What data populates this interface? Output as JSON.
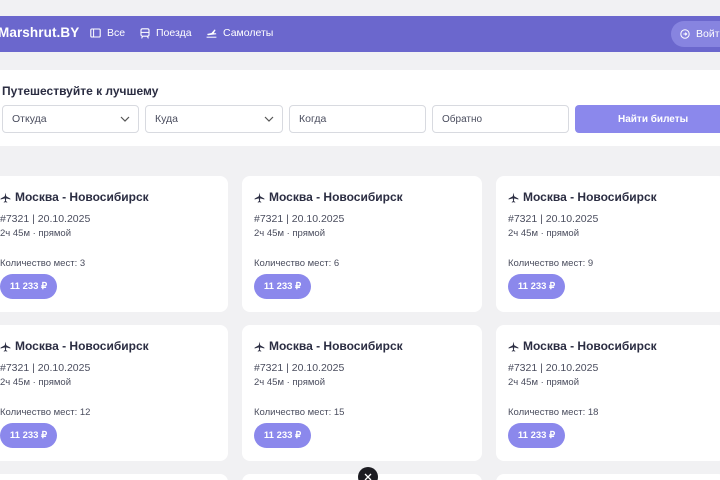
{
  "header": {
    "brand": "Marshrut.BY",
    "nav": [
      {
        "label": "Все",
        "icon": "ticket-icon"
      },
      {
        "label": "Поезда",
        "icon": "train-icon"
      },
      {
        "label": "Самолеты",
        "icon": "plane-icon"
      }
    ],
    "login_label": "Войти",
    "accent_color": "#6b67cd"
  },
  "search": {
    "title": "Путешествуйте к лучшему",
    "from_value": "Откуда",
    "to_value": "Куда",
    "when_placeholder": "Когда",
    "back_placeholder": "Обратно",
    "submit_label": "Найти билеты"
  },
  "cards": [
    {
      "route": "Москва - Новосибирск",
      "code": "#7321 | 20.10.2025",
      "duration": "2ч 45м · прямой",
      "seats": "Количество мест: 3",
      "price": "11 233 ₽"
    },
    {
      "route": "Москва - Новосибирск",
      "code": "#7321 | 20.10.2025",
      "duration": "2ч 45м · прямой",
      "seats": "Количество мест: 6",
      "price": "11 233 ₽"
    },
    {
      "route": "Москва - Новосибирск",
      "code": "#7321 | 20.10.2025",
      "duration": "2ч 45м · прямой",
      "seats": "Количество мест: 9",
      "price": "11 233 ₽"
    },
    {
      "route": "Москва - Новосибирск",
      "code": "#7321 | 20.10.2025",
      "duration": "2ч 45м · прямой",
      "seats": "Количество мест: 12",
      "price": "11 233 ₽"
    },
    {
      "route": "Москва - Новосибирск",
      "code": "#7321 | 20.10.2025",
      "duration": "2ч 45м · прямой",
      "seats": "Количество мест: 15",
      "price": "11 233 ₽"
    },
    {
      "route": "Москва - Новосибирск",
      "code": "#7321 | 20.10.2025",
      "duration": "2ч 45м · прямой",
      "seats": "Количество мест: 18",
      "price": "11 233 ₽"
    }
  ]
}
